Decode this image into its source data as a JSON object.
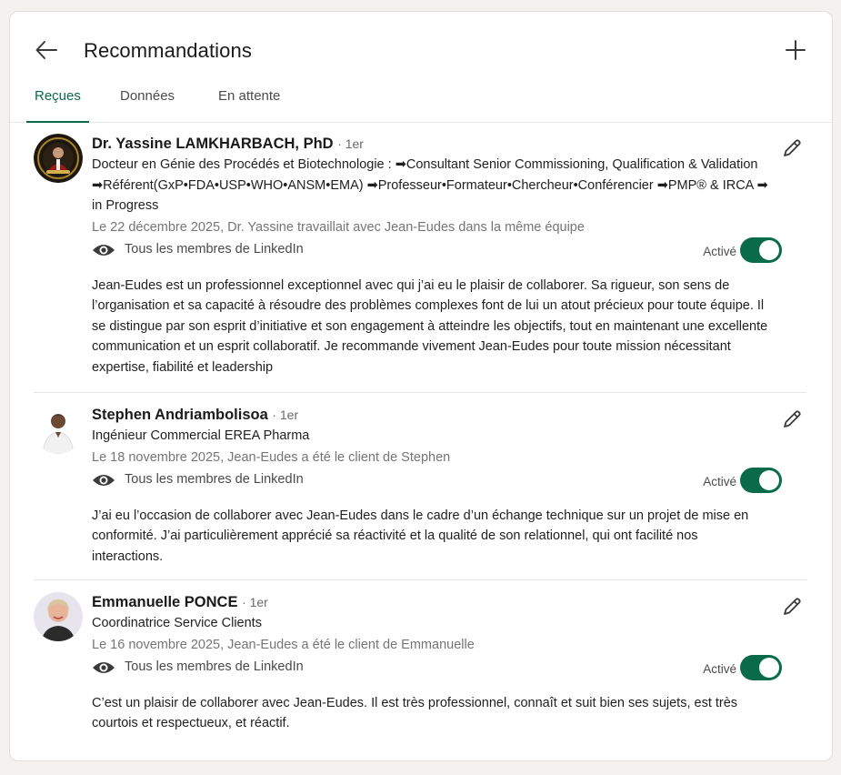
{
  "header": {
    "title": "Recommandations",
    "back_icon": "arrow-left-icon",
    "add_icon": "plus-icon"
  },
  "tabs": [
    {
      "label": "Reçues",
      "active": true
    },
    {
      "label": "Données",
      "active": false
    },
    {
      "label": "En attente",
      "active": false
    }
  ],
  "colors": {
    "accent": "#0a6b4a",
    "muted_text": "#757575"
  },
  "recommendations": [
    {
      "name": "Dr. Yassine LAMKHARBACH, PhD",
      "degree": "· 1er",
      "headline": "Docteur en Génie des Procédés et Biotechnologie : ➡Consultant Senior Commissioning, Qualification & Validation ➡Référent(GxP•FDA•USP•WHO•ANSM•EMA) ➡Professeur•Formateur•Chercheur•Conférencier ➡PMP® & IRCA ➡ in Progress",
      "date": "Le 22 décembre 2025, Dr. Yassine travaillait avec Jean-Eudes dans la même équipe",
      "visibility": "Tous les membres de LinkedIn",
      "status_label": "Activé",
      "text": "Jean-Eudes est un professionnel exceptionnel avec qui j’ai eu le plaisir de collaborer. Sa rigueur, son sens de l’organisation et sa capacité à résoudre des problèmes complexes font de lui un atout précieux pour toute équipe. Il se distingue par son esprit d’initiative et son engagement à atteindre les objectifs, tout en maintenant une excellente communication et un esprit collaboratif. Je recommande vivement Jean-Eudes pour toute mission nécessitant expertise, fiabilité et leadership"
    },
    {
      "name": "Stephen Andriambolisoa",
      "degree": "· 1er",
      "headline": "Ingénieur Commercial EREA Pharma",
      "date": "Le 18 novembre 2025, Jean-Eudes a été le client de Stephen",
      "visibility": "Tous les membres de LinkedIn",
      "status_label": "Activé",
      "text": "J’ai eu l’occasion de collaborer avec Jean-Eudes dans le cadre d’un échange technique sur un projet de mise en conformité. J’ai particulièrement apprécié sa réactivité et la qualité de son relationnel, qui ont facilité nos interactions."
    },
    {
      "name": "Emmanuelle PONCE",
      "degree": "· 1er",
      "headline": "Coordinatrice Service Clients",
      "date": "Le 16 novembre 2025, Jean-Eudes a été le client de Emmanuelle",
      "visibility": "Tous les membres de LinkedIn",
      "status_label": "Activé",
      "text": "C’est un plaisir de collaborer avec Jean-Eudes. Il est très professionnel, connaît et suit bien ses sujets, est très courtois et respectueux, et réactif."
    }
  ]
}
